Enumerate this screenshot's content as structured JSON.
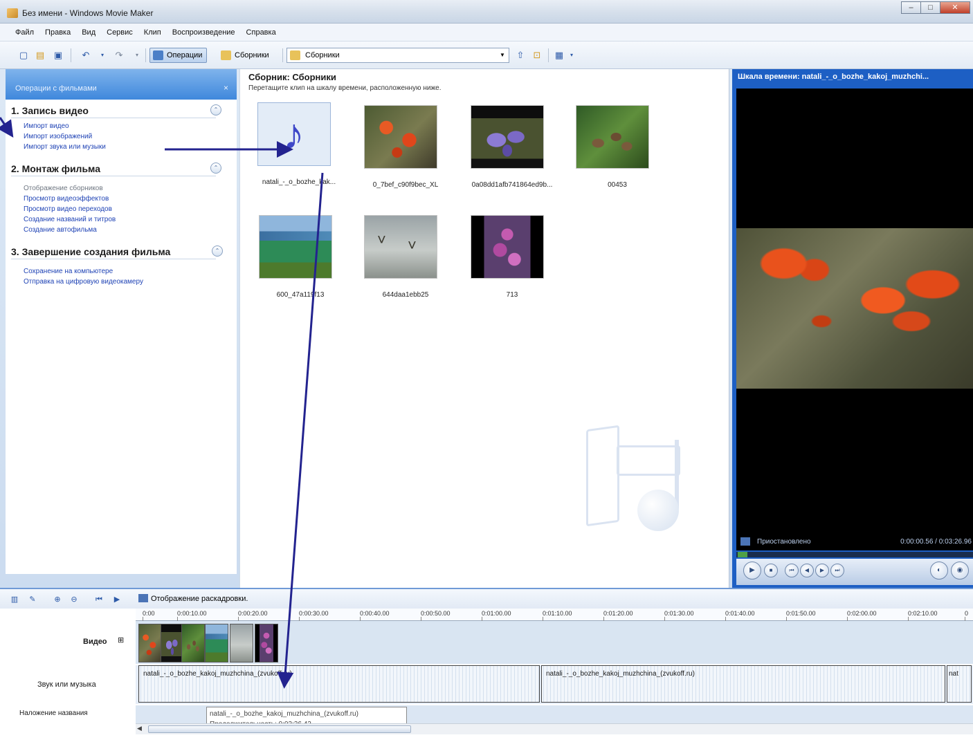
{
  "window": {
    "title": "Без имени - Windows Movie Maker",
    "min_label": "–",
    "max_label": "□",
    "close_label": "✕"
  },
  "menu": [
    "Файл",
    "Правка",
    "Вид",
    "Сервис",
    "Клип",
    "Воспроизведение",
    "Справка"
  ],
  "toolbar": {
    "tasks_label": "Операции",
    "collections_label": "Сборники",
    "combo_value": "Сборники"
  },
  "tasks_pane": {
    "header": "Операции с фильмами",
    "close": "×",
    "collapse_glyph": "⌃",
    "sections": [
      {
        "title": "1. Запись видео",
        "links": [
          {
            "label": "Импорт видео",
            "dim": false
          },
          {
            "label": "Импорт изображений",
            "dim": false
          },
          {
            "label": "Импорт звука или музыки",
            "dim": false
          }
        ]
      },
      {
        "title": "2. Монтаж фильма",
        "links": [
          {
            "label": "Отображение сборников",
            "dim": true
          },
          {
            "label": "Просмотр видеоэффектов",
            "dim": false
          },
          {
            "label": "Просмотр видео переходов",
            "dim": false
          },
          {
            "label": "Создание названий и титров",
            "dim": false
          },
          {
            "label": "Создание автофильма",
            "dim": false
          }
        ]
      },
      {
        "title": "3. Завершение создания фильма",
        "links": [
          {
            "label": "Сохранение на компьютере",
            "dim": false
          },
          {
            "label": "Отправка на цифровую видеокамеру",
            "dim": false
          }
        ]
      }
    ]
  },
  "collection": {
    "title": "Сборник: Сборники",
    "hint": "Перетащите клип на шкалу времени, расположенную ниже.",
    "clips": [
      {
        "caption": "natali_-_o_bozhe_kak...",
        "kind": "music"
      },
      {
        "caption": "0_7bef_c90f9bec_XL",
        "kind": "lily"
      },
      {
        "caption": "0a08dd1afb741864ed9b...",
        "kind": "crocus"
      },
      {
        "caption": "00453",
        "kind": "cones"
      },
      {
        "caption": "600_47a119f13",
        "kind": "house"
      },
      {
        "caption": "644daa1ebb25",
        "kind": "gulls"
      },
      {
        "caption": "713",
        "kind": "lilac"
      }
    ]
  },
  "monitor": {
    "title": "Шкала времени: natali_-_o_bozhe_kakoj_muzhchi...",
    "status": "Приостановлено",
    "time": "0:00:00.56 / 0:03:26.96"
  },
  "timeline": {
    "storyboard_toggle": "Отображение раскадровки.",
    "ruler": [
      "0:00",
      "0:00:10.00",
      "0:00:20.00",
      "0:00:30.00",
      "0:00:40.00",
      "0:00:50.00",
      "0:01:00.00",
      "0:01:10.00",
      "0:01:20.00",
      "0:01:30.00",
      "0:01:40.00",
      "0:01:50.00",
      "0:02:00.00",
      "0:02:10.00",
      "0"
    ],
    "video_label": "Видео",
    "expand_glyph": "⊞",
    "audio_label": "Звук или музыка",
    "title_overlay_label": "Наложение названия",
    "audio_clip_1": "natali_-_o_bozhe_kakoj_muzhchina_(zvukoff.ru)",
    "audio_clip_2": "natali_-_o_bozhe_kakoj_muzhchina_(zvukoff.ru)",
    "audio_clip_3": "nat",
    "tooltip_name": "natali_-_o_bozhe_kakoj_muzhchina_(zvukoff.ru)",
    "tooltip_duration": "Продолжительность: 0:03:26.42"
  }
}
